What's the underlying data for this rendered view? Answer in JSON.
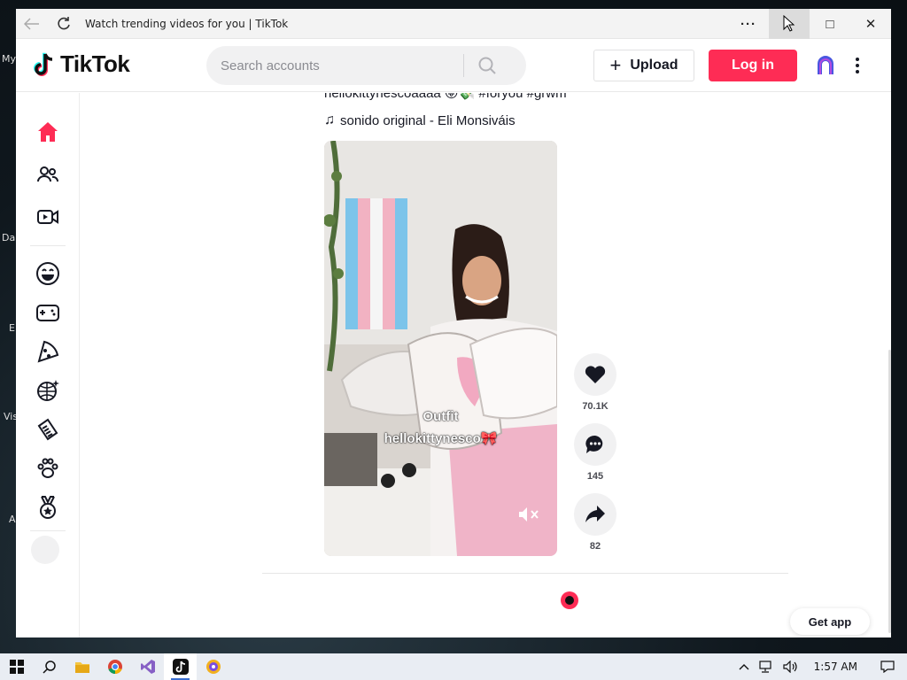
{
  "desktop": {
    "labels": [
      "My",
      "Da",
      "E",
      "Vis",
      "A"
    ]
  },
  "window": {
    "title": "Watch trending videos for you | TikTok",
    "more_label": "···",
    "minimize_label": "—",
    "maximize_label": "□",
    "close_label": "✕"
  },
  "header": {
    "logo_text": "TikTok",
    "search_placeholder": "Search accounts",
    "upload_label": "Upload",
    "upload_plus": "+",
    "login_label": "Log in"
  },
  "sidebar": {
    "items": [
      {
        "name": "home-icon",
        "icon": "home"
      },
      {
        "name": "following-icon",
        "icon": "people"
      },
      {
        "name": "live-icon",
        "icon": "video"
      },
      {
        "name": "comedy-icon",
        "icon": "laugh"
      },
      {
        "name": "gaming-icon",
        "icon": "gamepad"
      },
      {
        "name": "food-icon",
        "icon": "pizza"
      },
      {
        "name": "dance-icon",
        "icon": "discoball"
      },
      {
        "name": "beauty-icon",
        "icon": "comb"
      },
      {
        "name": "animals-icon",
        "icon": "paw"
      },
      {
        "name": "sports-icon",
        "icon": "medal"
      }
    ],
    "accent": "#fe2c55"
  },
  "post": {
    "partial_description": "hellokittynescoaaaa 😜💸 #foryou #grwm",
    "music": "sonido original - Eli Monsiváis",
    "music_note": "♫",
    "caption_line1": "Outfit",
    "caption_line2": "hellokittynesco🎀",
    "likes": "70.1K",
    "comments": "145",
    "shares": "82"
  },
  "get_app_label": "Get app",
  "taskbar": {
    "time": "1:57 AM",
    "apps": [
      "start",
      "search",
      "file-explorer",
      "chrome",
      "visual-studio",
      "tiktok",
      "app-extra"
    ]
  },
  "colors": {
    "brand_red": "#fe2c55",
    "text_dark": "#161823"
  }
}
